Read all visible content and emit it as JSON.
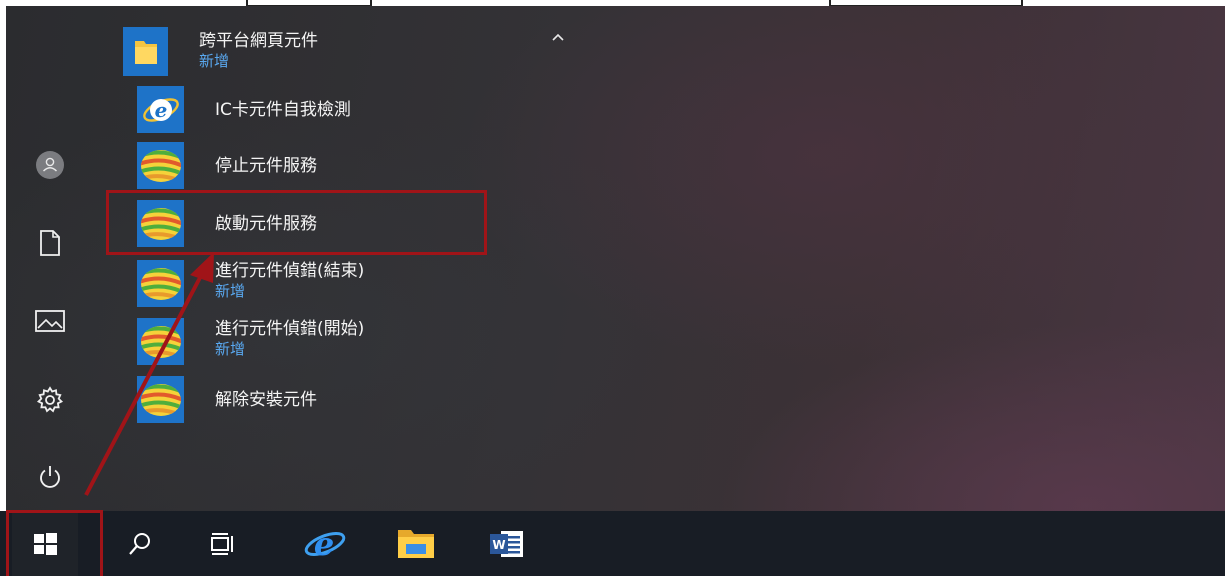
{
  "start_menu": {
    "group": {
      "title": "跨平台網頁元件",
      "badge": "新增",
      "icon": "folder-icon"
    },
    "apps": [
      {
        "name": "IC卡元件自我檢測",
        "badge": "",
        "icon": "ie-icon"
      },
      {
        "name": "停止元件服務",
        "badge": "",
        "icon": "service-globe-icon"
      },
      {
        "name": "啟動元件服務",
        "badge": "",
        "icon": "service-globe-icon"
      },
      {
        "name": "進行元件偵錯(結束)",
        "badge": "新增",
        "icon": "service-globe-icon"
      },
      {
        "name": "進行元件偵錯(開始)",
        "badge": "新增",
        "icon": "service-globe-icon"
      },
      {
        "name": "解除安裝元件",
        "badge": "",
        "icon": "service-globe-icon"
      }
    ],
    "left_rail": [
      "user-icon",
      "documents-icon",
      "pictures-icon",
      "settings-icon",
      "power-icon"
    ]
  },
  "taskbar": {
    "items": [
      "windows-start-icon",
      "search-icon",
      "task-view-icon",
      "ie-icon",
      "file-explorer-icon",
      "word-icon"
    ]
  },
  "colors": {
    "tile_blue": "#1e73c8",
    "accent_text": "#59a8f0",
    "annotation_red": "#a01418",
    "taskbar": "#181d25"
  }
}
